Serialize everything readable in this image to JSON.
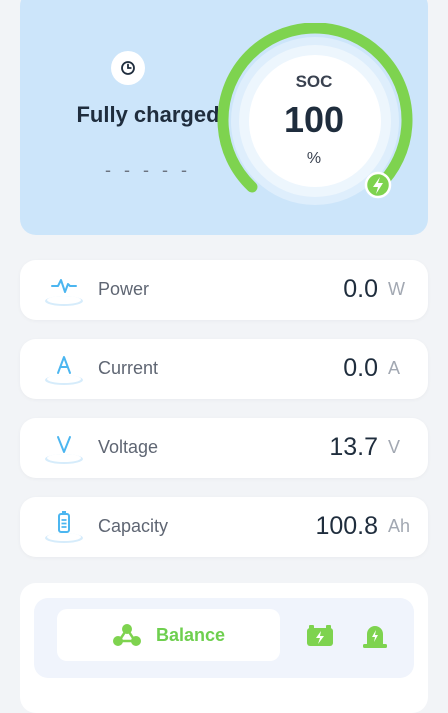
{
  "status": {
    "title": "Fully charged",
    "sub": "- - - - -"
  },
  "soc": {
    "label": "SOC",
    "value": "100",
    "unit": "%",
    "level": 1.0,
    "accent": "#7ed34f"
  },
  "metrics": [
    {
      "label": "Power",
      "value": "0.0",
      "unit": "W",
      "icon": "power-wave-icon"
    },
    {
      "label": "Current",
      "value": "0.0",
      "unit": "A",
      "icon": "current-a-icon"
    },
    {
      "label": "Voltage",
      "value": "13.7",
      "unit": "V",
      "icon": "voltage-v-icon"
    },
    {
      "label": "Capacity",
      "value": "100.8",
      "unit": "Ah",
      "icon": "battery-capacity-icon"
    }
  ],
  "tabs": {
    "balance_label": "Balance",
    "icons": [
      "balance-icon",
      "battery-charge-icon",
      "alarm-light-icon"
    ]
  },
  "colors": {
    "hero_bg": "#cce5fa",
    "icon_blue": "#4cb6f0",
    "green": "#7ed34f"
  }
}
